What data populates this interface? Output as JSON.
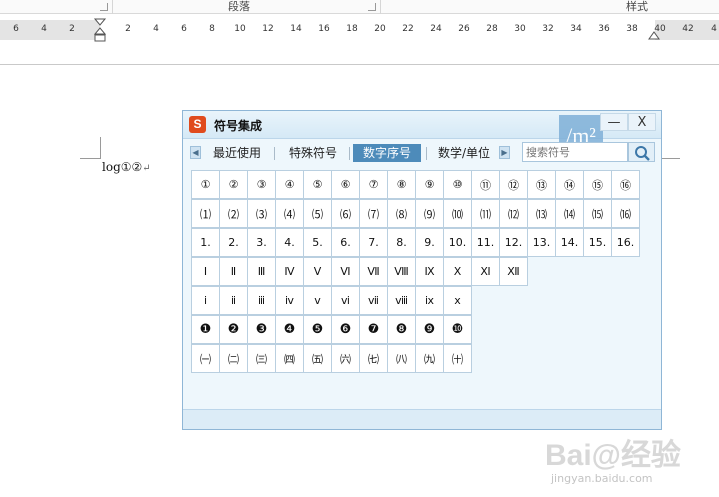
{
  "ribbon": {
    "paragraph_label": "段落",
    "styles_label": "样式"
  },
  "ruler": {
    "ticks": [
      "6",
      "4",
      "2",
      "2",
      "4",
      "6",
      "8",
      "10",
      "12",
      "14",
      "16",
      "18",
      "20",
      "22",
      "24",
      "26",
      "28",
      "30",
      "32",
      "34",
      "36",
      "38",
      "40",
      "42",
      "4"
    ]
  },
  "document": {
    "text": "log①②",
    "paragraph_mark": "↵"
  },
  "dialog": {
    "title": "符号集成",
    "logo_letter": "S",
    "minimize_label": "—",
    "close_label": "X",
    "watermark_text": "/m²",
    "tabs": [
      "最近使用",
      "特殊符号",
      "数字序号",
      "数学/单位"
    ],
    "selected_tab": "数字序号",
    "left_arrow": "◀",
    "right_arrow": "▶",
    "search_placeholder": "搜索符号",
    "rows": [
      [
        "①",
        "②",
        "③",
        "④",
        "⑤",
        "⑥",
        "⑦",
        "⑧",
        "⑨",
        "⑩",
        "⑪",
        "⑫",
        "⑬",
        "⑭",
        "⑮",
        "⑯"
      ],
      [
        "⑴",
        "⑵",
        "⑶",
        "⑷",
        "⑸",
        "⑹",
        "⑺",
        "⑻",
        "⑼",
        "⑽",
        "⑾",
        "⑿",
        "⒀",
        "⒁",
        "⒂",
        "⒃"
      ],
      [
        "1.",
        "2.",
        "3.",
        "4.",
        "5.",
        "6.",
        "7.",
        "8.",
        "9.",
        "10.",
        "11.",
        "12.",
        "13.",
        "14.",
        "15.",
        "16."
      ],
      [
        "Ⅰ",
        "Ⅱ",
        "Ⅲ",
        "Ⅳ",
        "Ⅴ",
        "Ⅵ",
        "Ⅶ",
        "Ⅷ",
        "Ⅸ",
        "Ⅹ",
        "Ⅺ",
        "Ⅻ"
      ],
      [
        "ⅰ",
        "ⅱ",
        "ⅲ",
        "ⅳ",
        "ⅴ",
        "ⅵ",
        "ⅶ",
        "ⅷ",
        "ⅸ",
        "ⅹ"
      ],
      [
        "❶",
        "❷",
        "❸",
        "❹",
        "❺",
        "❻",
        "❼",
        "❽",
        "❾",
        "❿"
      ],
      [
        "㈠",
        "㈡",
        "㈢",
        "㈣",
        "㈤",
        "㈥",
        "㈦",
        "㈧",
        "㈨",
        "㈩"
      ]
    ]
  },
  "watermark": {
    "brand": "Bai@经验",
    "url": "jingyan.baidu.com"
  }
}
